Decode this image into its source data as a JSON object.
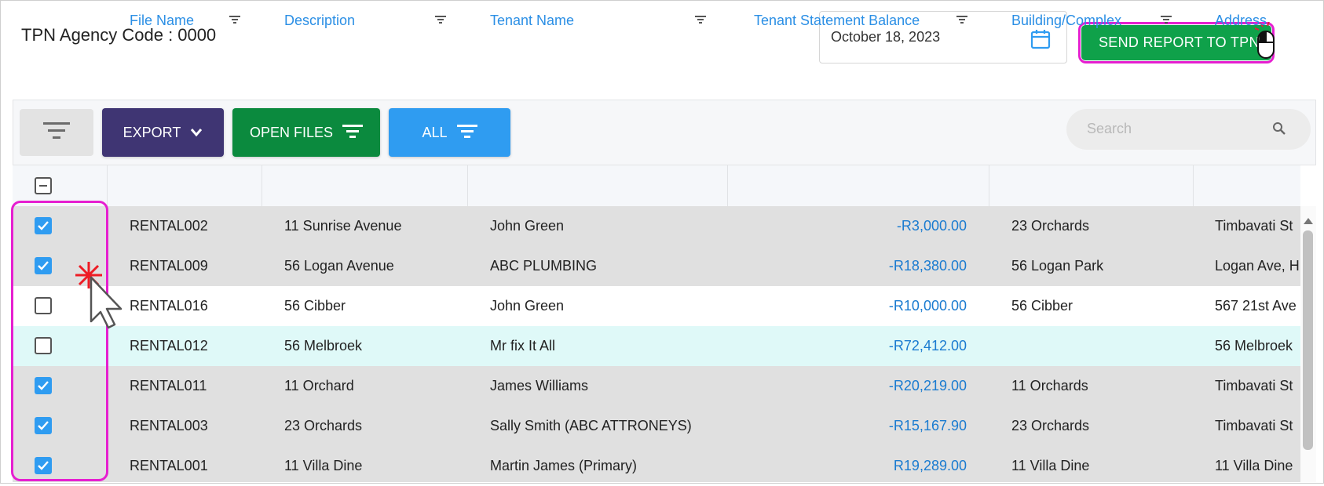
{
  "header": {
    "agency_label": "TPN Agency Code :",
    "agency_code": "0000",
    "date_value": "October 18, 2023",
    "send_button_label": "SEND REPORT TO TPN"
  },
  "toolbar": {
    "export_label": "EXPORT",
    "open_files_label": "OPEN FILES",
    "all_label": "ALL",
    "search_placeholder": "Search"
  },
  "table": {
    "columns": [
      "File Name",
      "Description",
      "Tenant Name",
      "Tenant Statement Balance",
      "Building/Complex",
      "Address"
    ],
    "rows": [
      {
        "checked": true,
        "file": "RENTAL002",
        "description": "11 Sunrise Avenue",
        "tenant": "John Green",
        "balance": "-R3,000.00",
        "building": "23 Orchards",
        "address": "Timbavati St"
      },
      {
        "checked": true,
        "file": "RENTAL009",
        "description": "56 Logan Avenue",
        "tenant": "ABC PLUMBING",
        "balance": "-R18,380.00",
        "building": "56 Logan Park",
        "address": "Logan Ave, H"
      },
      {
        "checked": false,
        "file": "RENTAL016",
        "description": "56 Cibber",
        "tenant": "John Green",
        "balance": "-R10,000.00",
        "building": "56 Cibber",
        "address": "567 21st Ave"
      },
      {
        "checked": false,
        "file": "RENTAL012",
        "description": "56 Melbroek",
        "tenant": "Mr fix It All",
        "balance": "-R72,412.00",
        "building": "",
        "address": "56 Melbroek"
      },
      {
        "checked": true,
        "file": "RENTAL011",
        "description": "11 Orchard",
        "tenant": "James Williams",
        "balance": "-R20,219.00",
        "building": "11 Orchards",
        "address": "Timbavati St"
      },
      {
        "checked": true,
        "file": "RENTAL003",
        "description": "23 Orchards",
        "tenant": "Sally Smith (ABC ATTRONEYS)",
        "balance": "-R15,167.90",
        "building": "23 Orchards",
        "address": "Timbavati St"
      },
      {
        "checked": true,
        "file": "RENTAL001",
        "description": "11 Villa Dine",
        "tenant": "Martin James (Primary)",
        "balance": "R19,289.00",
        "building": "11 Villa Dine",
        "address": "11 Villa Dine"
      }
    ]
  },
  "colors": {
    "highlight": "#e61fd0",
    "send_button": "#0fa14a",
    "export_button": "#3f3573",
    "open_files_button": "#0b8a3e",
    "all_button": "#2f9cf1",
    "selected_row_bg": "#e0e0e0",
    "hover_row_bg": "#dff9f8",
    "header_text": "#2b8fe5"
  }
}
